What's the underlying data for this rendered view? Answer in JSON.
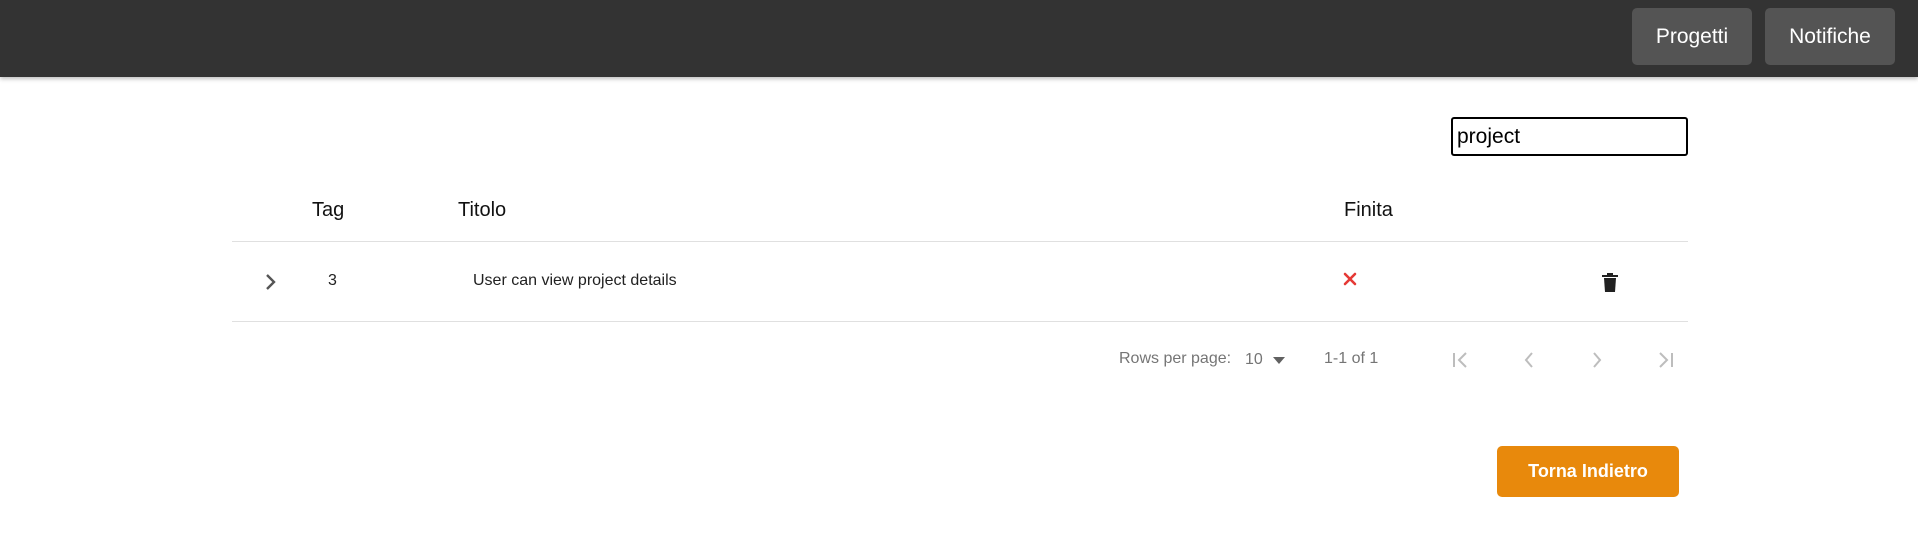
{
  "nav": {
    "projects_label": "Progetti",
    "notifications_label": "Notifiche"
  },
  "search": {
    "value": "project"
  },
  "table": {
    "columns": {
      "tag": "Tag",
      "title": "Titolo",
      "done": "Finita"
    },
    "rows": [
      {
        "tag": "3",
        "title": "User can view project details",
        "done_icon": "close-icon"
      }
    ]
  },
  "pagination": {
    "rows_per_page_label": "Rows per page:",
    "rows_per_page_value": "10",
    "range_text": "1-1 of 1"
  },
  "actions": {
    "back_label": "Torna Indietro"
  },
  "colors": {
    "topbar": "#333333",
    "nav_button": "#545454",
    "accent_orange": "#e8890c",
    "status_red": "#e53935"
  }
}
